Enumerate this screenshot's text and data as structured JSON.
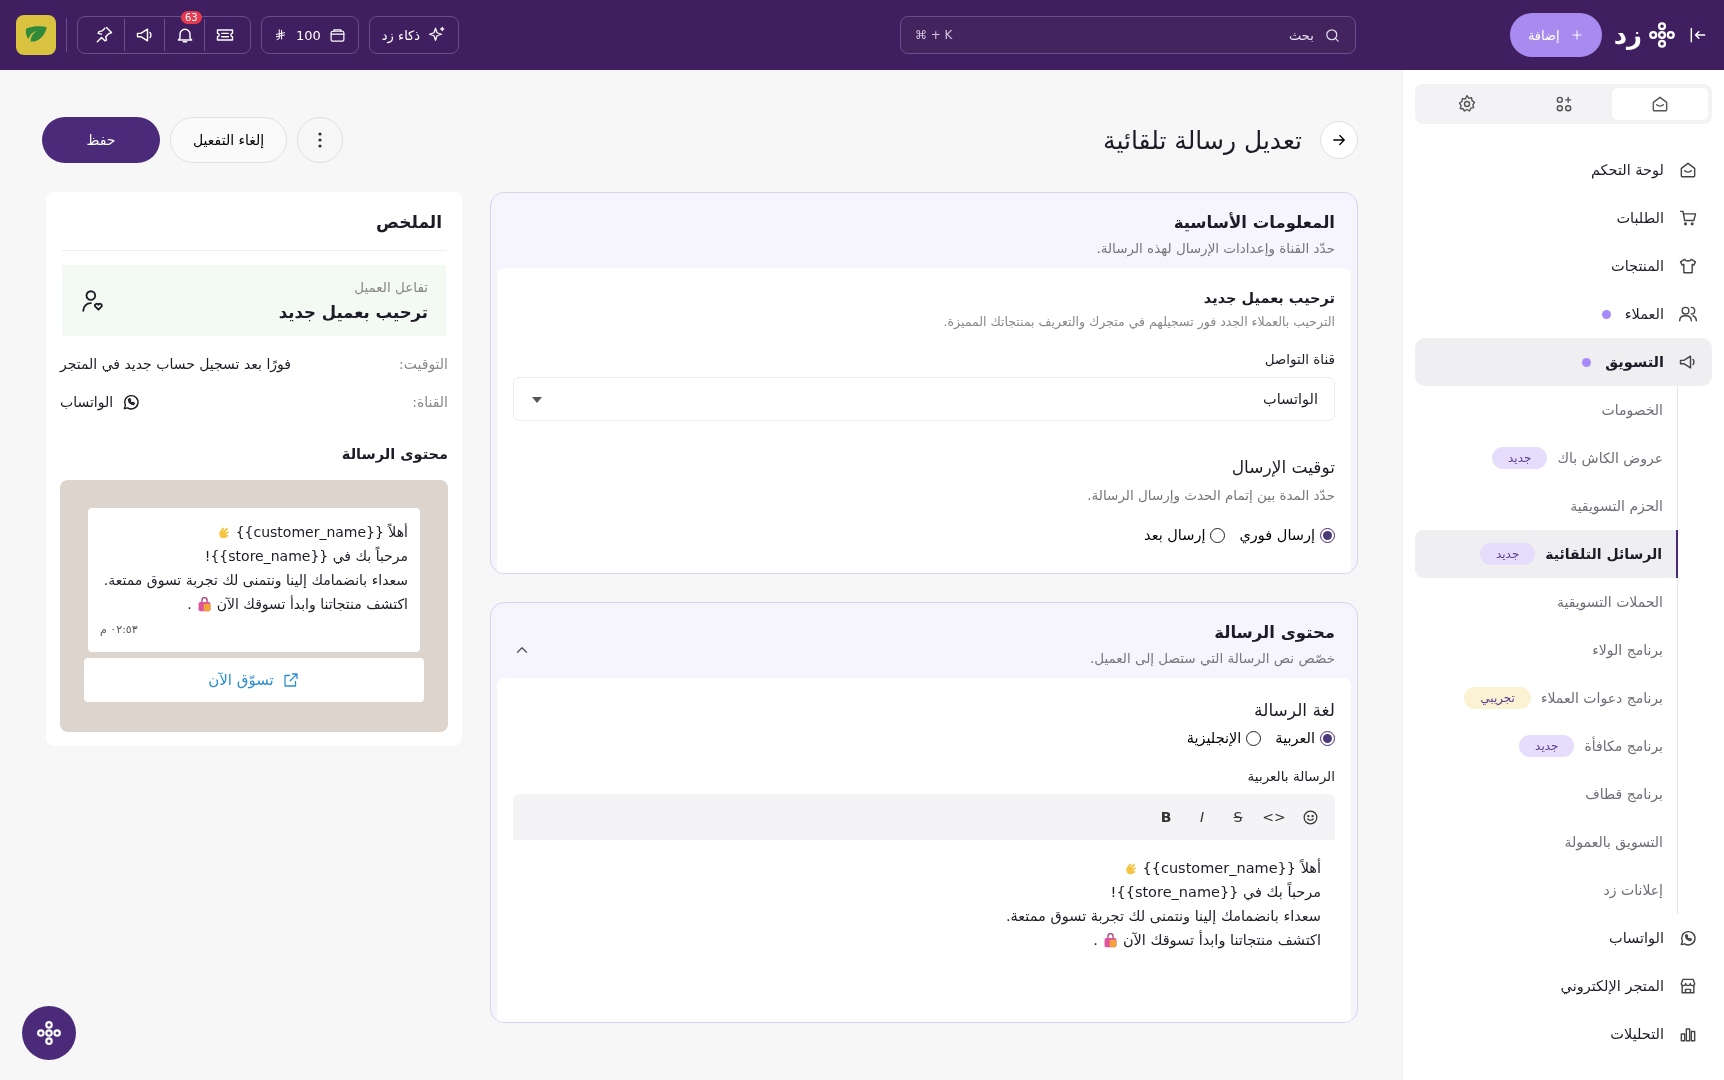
{
  "topbar": {
    "logo_text": "زد",
    "add_button": "إضافة",
    "search": {
      "placeholder": "بحث",
      "shortcut": "⌘ + K"
    },
    "ai_button": "ذكاء زد",
    "wallet": "100",
    "notifications_badge": "63"
  },
  "sidebar": {
    "tabs": [
      {
        "selected": true
      },
      {
        "selected": false
      },
      {
        "selected": false
      }
    ],
    "items": [
      {
        "label": "لوحة التحكم",
        "selected": false
      },
      {
        "label": "الطلبات",
        "selected": false
      },
      {
        "label": "المنتجات",
        "selected": false
      },
      {
        "label": "العملاء",
        "selected": false,
        "color": "#a78bfa"
      },
      {
        "label": "التسويق",
        "selected": true,
        "color": "#a78bfa",
        "expanded": true,
        "children": [
          {
            "label": "الخصومات",
            "selected": false
          },
          {
            "label": "عروض الكاش باك",
            "selected": false,
            "badge": {
              "label": "جديد",
              "color": "#e6dcfb"
            }
          },
          {
            "label": "الحزم التسويقية",
            "selected": false
          },
          {
            "label": "الرسائل التلقائية",
            "selected": true,
            "badge": {
              "label": "جديد",
              "color": "#e6dcfb"
            }
          },
          {
            "label": "الحملات التسويقية",
            "selected": false
          },
          {
            "label": "برنامج الولاء",
            "selected": false
          },
          {
            "label": "برنامج دعوات العملاء",
            "selected": false,
            "badge": {
              "label": "تجريبي",
              "color": "#fbf2d3"
            }
          },
          {
            "label": "برنامج مكافأة",
            "selected": false,
            "badge": {
              "label": "جديد",
              "color": "#e6dcfb"
            }
          },
          {
            "label": "برنامج قطاف",
            "selected": false
          },
          {
            "label": "التسويق بالعمولة",
            "selected": false
          },
          {
            "label": "إعلانات زد",
            "selected": false
          }
        ]
      },
      {
        "label": "الواتساب",
        "selected": false
      },
      {
        "label": "المتجر الإلكتروني",
        "selected": false
      },
      {
        "label": "التحليلات",
        "selected": false
      }
    ]
  },
  "page": {
    "title": "تعديل رسالة تلقائية",
    "actions": {
      "save": "حفظ",
      "deactivate": "إلغاء التفعيل"
    }
  },
  "basic_info": {
    "title": "المعلومات الأساسية",
    "subtitle": "حدّد القناة وإعدادات الإرسال لهذه الرسالة.",
    "trigger_title": "ترحيب بعميل جديد",
    "trigger_description": "الترحيب بالعملاء الجدد فور تسجيلهم في متجرك والتعريف بمنتجاتك المميزة.",
    "channel_label": "قناة التواصل",
    "channel_value": "الواتساب",
    "timing": {
      "title": "توقيت الإرسال",
      "subtitle": "حدّد المدة بين إتمام الحدث وإرسال الرسالة.",
      "options": [
        {
          "label": "إرسال فوري",
          "selected": true
        },
        {
          "label": "إرسال بعد",
          "selected": false
        }
      ]
    }
  },
  "message_content": {
    "title": "محتوى الرسالة",
    "subtitle": "خصّص نص الرسالة التي ستصل إلى العميل.",
    "expanded": true,
    "language_label": "لغة الرسالة",
    "languages": [
      {
        "label": "العربية",
        "selected": true
      },
      {
        "label": "الإنجليزية",
        "selected": false
      }
    ],
    "editor_label": "الرسالة بالعربية",
    "toolbar": [
      {
        "kind": "emoji"
      },
      {
        "kind": "code",
        "label": "<>"
      },
      {
        "kind": "strike",
        "label": "S"
      },
      {
        "kind": "italic",
        "label": "I"
      },
      {
        "kind": "bold",
        "label": "B"
      }
    ],
    "lines": [
      {
        "kind": "wave",
        "text": "أهلاً {{customer_name}}"
      },
      {
        "kind": "plain",
        "text": "مرحباً بك في {{store_name}}!"
      },
      {
        "kind": "plain",
        "text": "سعداء بانضمامك إلينا ونتمنى لك تجربة تسوق ممتعة."
      },
      {
        "kind": "bag",
        "text": "اكتشف منتجاتنا وابدأ تسوقك الآن",
        "tail": "."
      }
    ]
  },
  "summary": {
    "title": "الملخص",
    "trigger_label": "تفاعل العميل",
    "trigger_value": "ترحيب بعميل جديد",
    "timing_label": "التوقيت:",
    "timing_value": "فورًا بعد تسجيل حساب جديد في المتجر",
    "channel_label": "القناة:",
    "channel_value": "الواتساب",
    "content_title": "محتوى الرسالة",
    "preview": {
      "lines": [
        {
          "kind": "wave",
          "text": "أهلاً {{customer_name}}"
        },
        {
          "kind": "plain",
          "text": "مرحباً بك في {{store_name}}!"
        },
        {
          "kind": "plain",
          "text": "سعداء بانضمامك إلينا ونتمنى لك تجربة تسوق ممتعة."
        },
        {
          "kind": "bag",
          "text": "اكتشف منتجاتنا وابدأ تسوقك الآن",
          "tail": "."
        }
      ],
      "time": "٠٢:٥٣ م",
      "button": "تسوّق الآن"
    }
  }
}
